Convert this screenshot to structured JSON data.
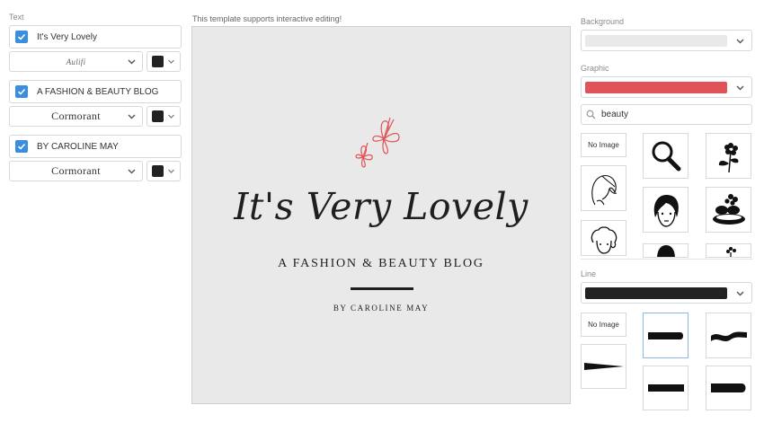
{
  "left_panel": {
    "section_label": "Text",
    "items": [
      {
        "text": "It's Very Lovely",
        "checked": true,
        "font": "Aulifi",
        "color": "#222222"
      },
      {
        "text": "A FASHION & BEAUTY BLOG",
        "checked": true,
        "font": "Cormorant",
        "color": "#222222"
      },
      {
        "text": "BY CAROLINE MAY",
        "checked": true,
        "font": "Cormorant",
        "color": "#222222"
      }
    ]
  },
  "center": {
    "hint": "This template supports interactive editing!",
    "preview_bg": "#e9e9e9",
    "title": "It's Very Lovely",
    "subtitle": "A FASHION & BEAUTY BLOG",
    "author": "BY CAROLINE MAY",
    "butterfly_color": "#e05358"
  },
  "right_panel": {
    "background_label": "Background",
    "background_color": "#e9e9e9",
    "graphic_label": "Graphic",
    "graphic_color": "#e05358",
    "search_value": "beauty",
    "no_image_label": "No Image",
    "graphic_icons": [
      "no-image",
      "magnifier-icon",
      "flower-plant-icon",
      "woman-profile-icon",
      "woman-face-icon",
      "spa-stones-icon",
      "woman-curly-hair-icon",
      "face-partial-icon",
      "flower-partial-icon"
    ],
    "line_label": "Line",
    "line_color": "#222222",
    "line_no_image_label": "No Image",
    "line_styles": [
      "no-image",
      "rounded-end-line",
      "wavy-line",
      "tapered-line",
      "flat-line",
      "rounded-right-line"
    ]
  }
}
